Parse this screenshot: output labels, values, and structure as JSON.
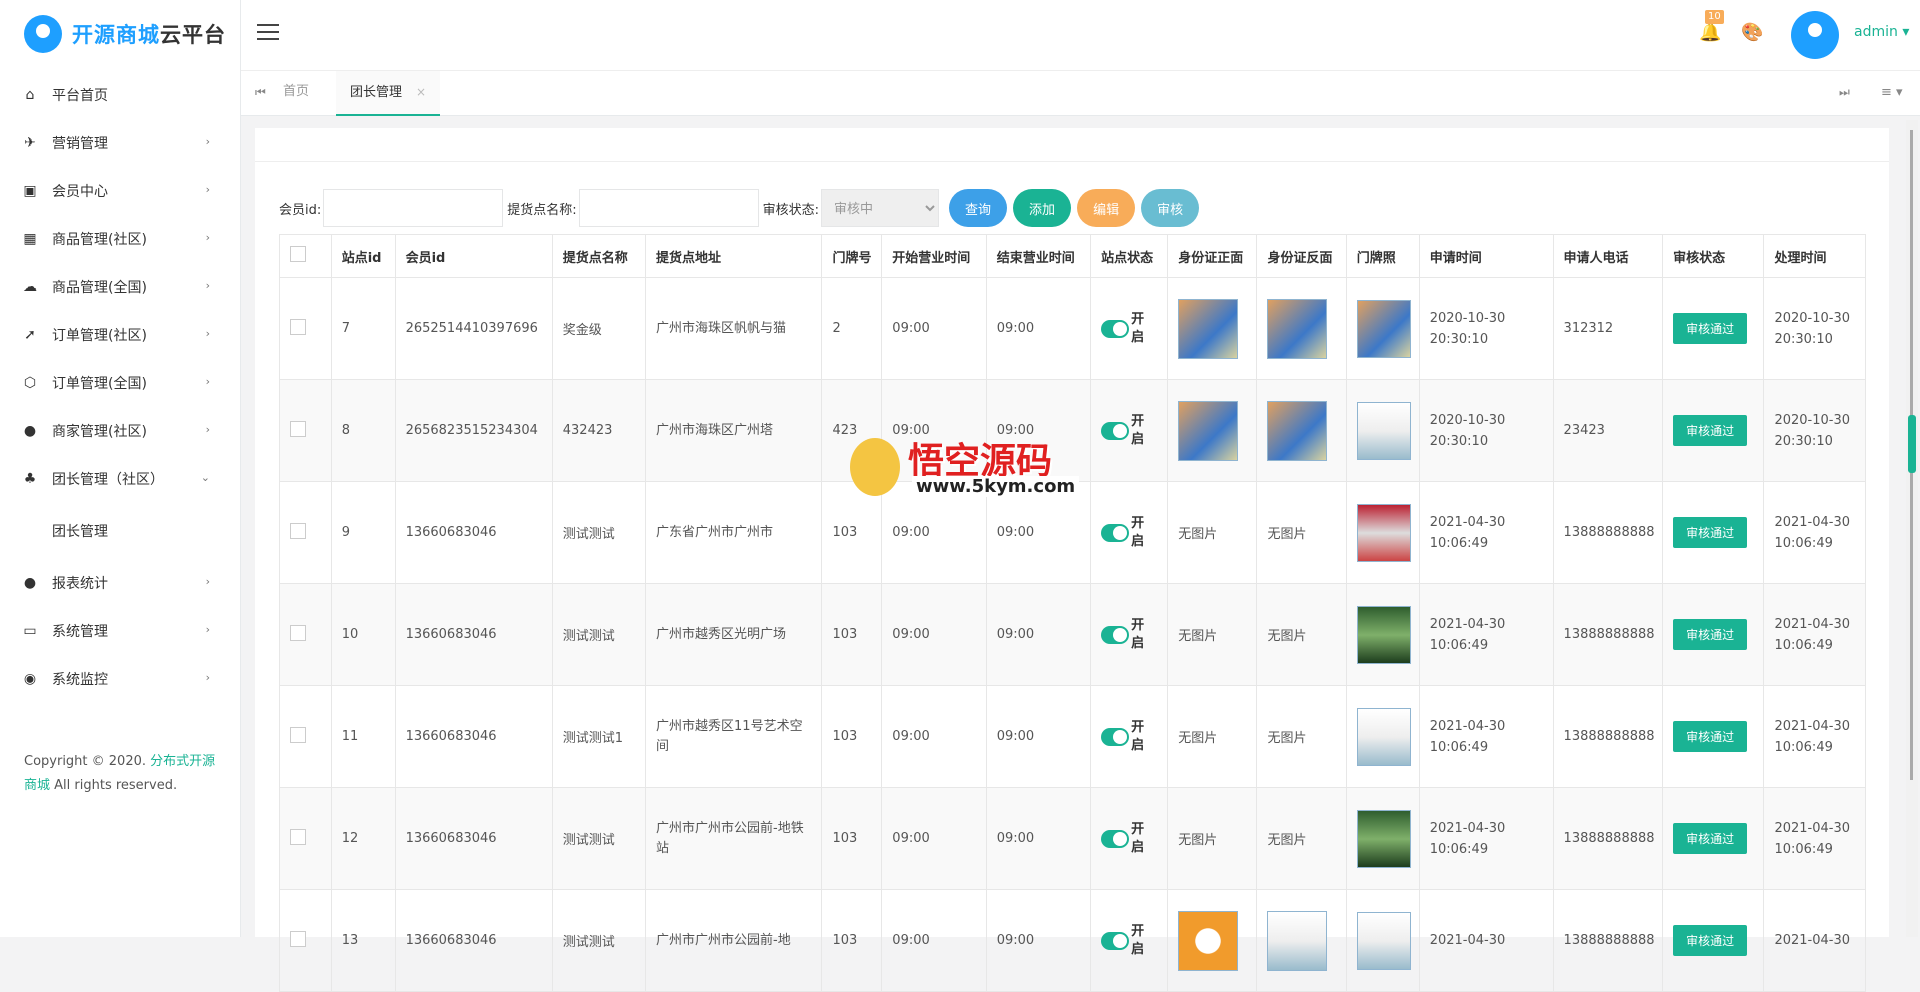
{
  "brand": {
    "part1": "开源商城",
    "part2": "云平台"
  },
  "sidebar": {
    "items": [
      {
        "label": "平台首页",
        "icon": "home-icon",
        "arrow": ""
      },
      {
        "label": "营销管理",
        "icon": "plane-icon",
        "arrow": "›"
      },
      {
        "label": "会员中心",
        "icon": "member-card-icon",
        "arrow": "›"
      },
      {
        "label": "商品管理(社区)",
        "icon": "grid-icon",
        "arrow": "›"
      },
      {
        "label": "商品管理(全国)",
        "icon": "cloud-icon",
        "arrow": "›"
      },
      {
        "label": "订单管理(社区)",
        "icon": "rocket-icon",
        "arrow": "›"
      },
      {
        "label": "订单管理(全国)",
        "icon": "cube-icon",
        "arrow": "›"
      },
      {
        "label": "商家管理(社区)",
        "icon": "user-icon",
        "arrow": "›"
      },
      {
        "label": "团长管理（社区）",
        "icon": "users-icon",
        "arrow": "⌄"
      }
    ],
    "sub_item": "团长管理",
    "items2": [
      {
        "label": "报表统计",
        "icon": "user-icon",
        "arrow": "›"
      },
      {
        "label": "系统管理",
        "icon": "laptop-icon",
        "arrow": "›"
      },
      {
        "label": "系统监控",
        "icon": "signal-icon",
        "arrow": "›"
      }
    ]
  },
  "copyright": {
    "pre": "Copyright © 2020. ",
    "link": "分布式开源商城",
    "post": " All rights reserved."
  },
  "header": {
    "badge": "10",
    "user": "admin"
  },
  "tabs": {
    "home": "首页",
    "active": "团长管理",
    "close": "×"
  },
  "filters": {
    "member_label": "会员id:",
    "name_label": "提货点名称:",
    "status_label": "审核状态:",
    "status_value": "审核中"
  },
  "buttons": {
    "query": "查询",
    "add": "添加",
    "edit": "编辑",
    "audit": "审核"
  },
  "columns": [
    "站点id",
    "会员id",
    "提货点名称",
    "提货点地址",
    "门牌号",
    "开始营业时间",
    "结束营业时间",
    "站点状态",
    "身份证正面",
    "身份证反面",
    "门牌照",
    "申请时间",
    "申请人电话",
    "审核状态",
    "处理时间"
  ],
  "rows": [
    {
      "id": "7",
      "member": "2652514410397696",
      "name": "奖金级",
      "addr": "广州市海珠区帆帆与猫",
      "door": "2",
      "start": "09:00",
      "end": "09:00",
      "switch": "开启",
      "front": "",
      "back": "",
      "apply_time": "2020-10-30 20:30:10",
      "phone": "312312",
      "status": "审核通过",
      "handle": "2020-10-30 20:30:10"
    },
    {
      "id": "8",
      "member": "2656823515234304",
      "name": "432423",
      "addr": "广州市海珠区广州塔",
      "door": "423",
      "start": "09:00",
      "end": "09:00",
      "switch": "开启",
      "front": "",
      "back": "",
      "apply_time": "2020-10-30 20:30:10",
      "phone": "23423",
      "status": "审核通过",
      "handle": "2020-10-30 20:30:10"
    },
    {
      "id": "9",
      "member": "13660683046",
      "name": "测试测试",
      "addr": "广东省广州市广州市",
      "door": "103",
      "start": "09:00",
      "end": "09:00",
      "switch": "开启",
      "front": "无图片",
      "back": "无图片",
      "apply_time": "2021-04-30 10:06:49",
      "phone": "13888888888",
      "status": "审核通过",
      "handle": "2021-04-30 10:06:49"
    },
    {
      "id": "10",
      "member": "13660683046",
      "name": "测试测试",
      "addr": "广州市越秀区光明广场",
      "door": "103",
      "start": "09:00",
      "end": "09:00",
      "switch": "开启",
      "front": "无图片",
      "back": "无图片",
      "apply_time": "2021-04-30 10:06:49",
      "phone": "13888888888",
      "status": "审核通过",
      "handle": "2021-04-30 10:06:49"
    },
    {
      "id": "11",
      "member": "13660683046",
      "name": "测试测试1",
      "addr": "广州市越秀区11号艺术空间",
      "door": "103",
      "start": "09:00",
      "end": "09:00",
      "switch": "开启",
      "front": "无图片",
      "back": "无图片",
      "apply_time": "2021-04-30 10:06:49",
      "phone": "13888888888",
      "status": "审核通过",
      "handle": "2021-04-30 10:06:49"
    },
    {
      "id": "12",
      "member": "13660683046",
      "name": "测试测试",
      "addr": "广州市广州市公园前-地铁站",
      "door": "103",
      "start": "09:00",
      "end": "09:00",
      "switch": "开启",
      "front": "无图片",
      "back": "无图片",
      "apply_time": "2021-04-30 10:06:49",
      "phone": "13888888888",
      "status": "审核通过",
      "handle": "2021-04-30 10:06:49"
    },
    {
      "id": "13",
      "member": "13660683046",
      "name": "测试测试",
      "addr": "广州市广州市公园前-地",
      "door": "103",
      "start": "09:00",
      "end": "09:00",
      "switch": "开启",
      "front": "",
      "back": "",
      "apply_time": "2021-04-30",
      "phone": "13888888888",
      "status": "审核通过",
      "handle": "2021-04-30"
    }
  ],
  "watermark": {
    "text": "悟空源码",
    "url": "www.5kym.com"
  }
}
